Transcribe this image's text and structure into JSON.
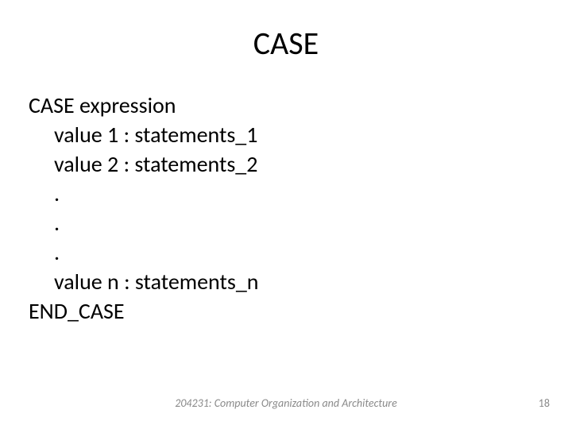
{
  "title": "CASE",
  "body": {
    "line1": "CASE expression",
    "line2": "value 1 : statements_1",
    "line3": "value 2 : statements_2",
    "dot1": ".",
    "dot2": ".",
    "dot3": ".",
    "line7": "value n : statements_n",
    "line8": "END_CASE"
  },
  "footer": "204231: Computer Organization and Architecture",
  "page_number": "18"
}
